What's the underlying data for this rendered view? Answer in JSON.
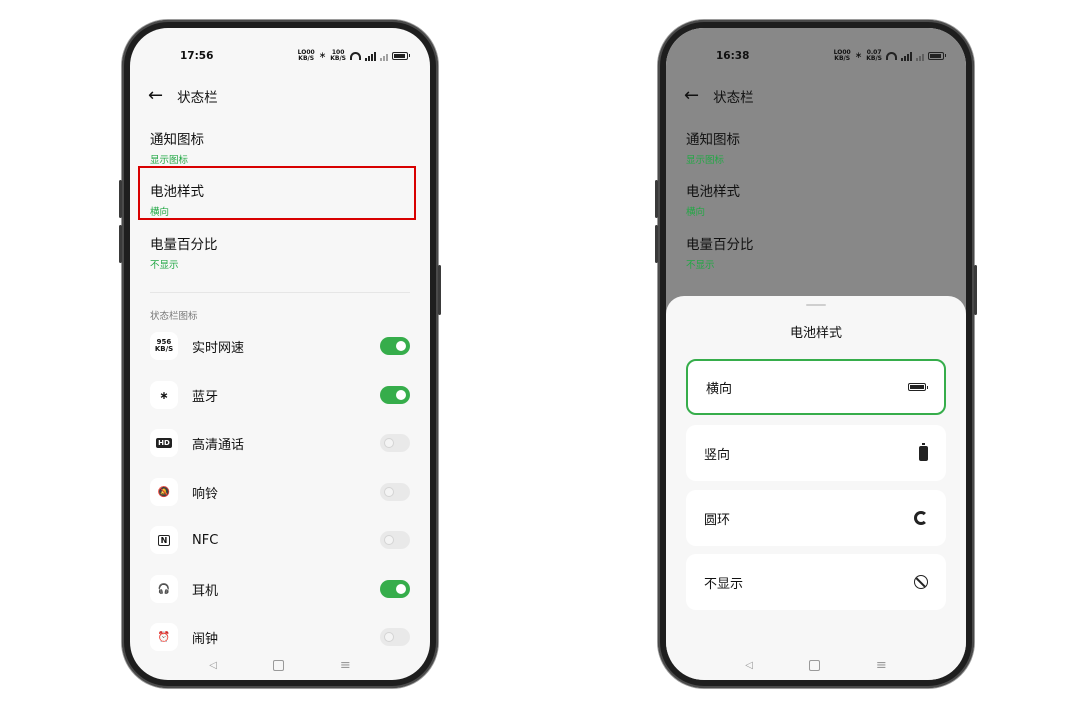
{
  "left_phone": {
    "status_time": "17:56",
    "status_icons": {
      "speed_top": "LO00",
      "speed_bottom": "KB/S",
      "data_top": "100",
      "data_bottom": "KB/S"
    },
    "header_title": "状态栏",
    "prefs": [
      {
        "title": "通知图标",
        "summary": "显示图标"
      },
      {
        "title": "电池样式",
        "summary": "横向"
      },
      {
        "title": "电量百分比",
        "summary": "不显示"
      }
    ],
    "section_label": "状态栏图标",
    "icons": [
      {
        "label": "实时网速",
        "icon": "network-speed-icon",
        "icon_top": "956",
        "icon_bottom": "KB/S",
        "enabled": true
      },
      {
        "label": "蓝牙",
        "icon": "bluetooth-icon",
        "glyph": "∗",
        "enabled": true
      },
      {
        "label": "高清通话",
        "icon": "hd-call-icon",
        "glyph": "HD",
        "enabled": false
      },
      {
        "label": "响铃",
        "icon": "bell-off-icon",
        "glyph": "🔕",
        "enabled": false
      },
      {
        "label": "NFC",
        "icon": "nfc-icon",
        "glyph": "N",
        "enabled": false
      },
      {
        "label": "耳机",
        "icon": "headphones-icon",
        "glyph": "🎧",
        "enabled": true
      },
      {
        "label": "闹钟",
        "icon": "alarm-clock-icon",
        "glyph": "⏰",
        "enabled": false
      }
    ]
  },
  "right_phone": {
    "status_time": "16:38",
    "status_icons": {
      "speed_top": "LO00",
      "speed_bottom": "KB/S",
      "data_top": "0.07",
      "data_bottom": "KB/S"
    },
    "header_title": "状态栏",
    "prefs": [
      {
        "title": "通知图标",
        "summary": "显示图标"
      },
      {
        "title": "电池样式",
        "summary": "横向"
      },
      {
        "title": "电量百分比",
        "summary": "不显示"
      }
    ],
    "sheet": {
      "title": "电池样式",
      "options": [
        {
          "label": "横向",
          "icon": "battery-horizontal-icon",
          "selected": true
        },
        {
          "label": "竖向",
          "icon": "battery-vertical-icon",
          "selected": false
        },
        {
          "label": "圆环",
          "icon": "battery-ring-icon",
          "selected": false
        },
        {
          "label": "不显示",
          "icon": "no-display-icon",
          "selected": false
        }
      ]
    }
  },
  "colors": {
    "accent": "#36ad4b",
    "summary_green": "#22a845",
    "highlight_red": "#d80000",
    "dim_overlay": "#888888"
  }
}
